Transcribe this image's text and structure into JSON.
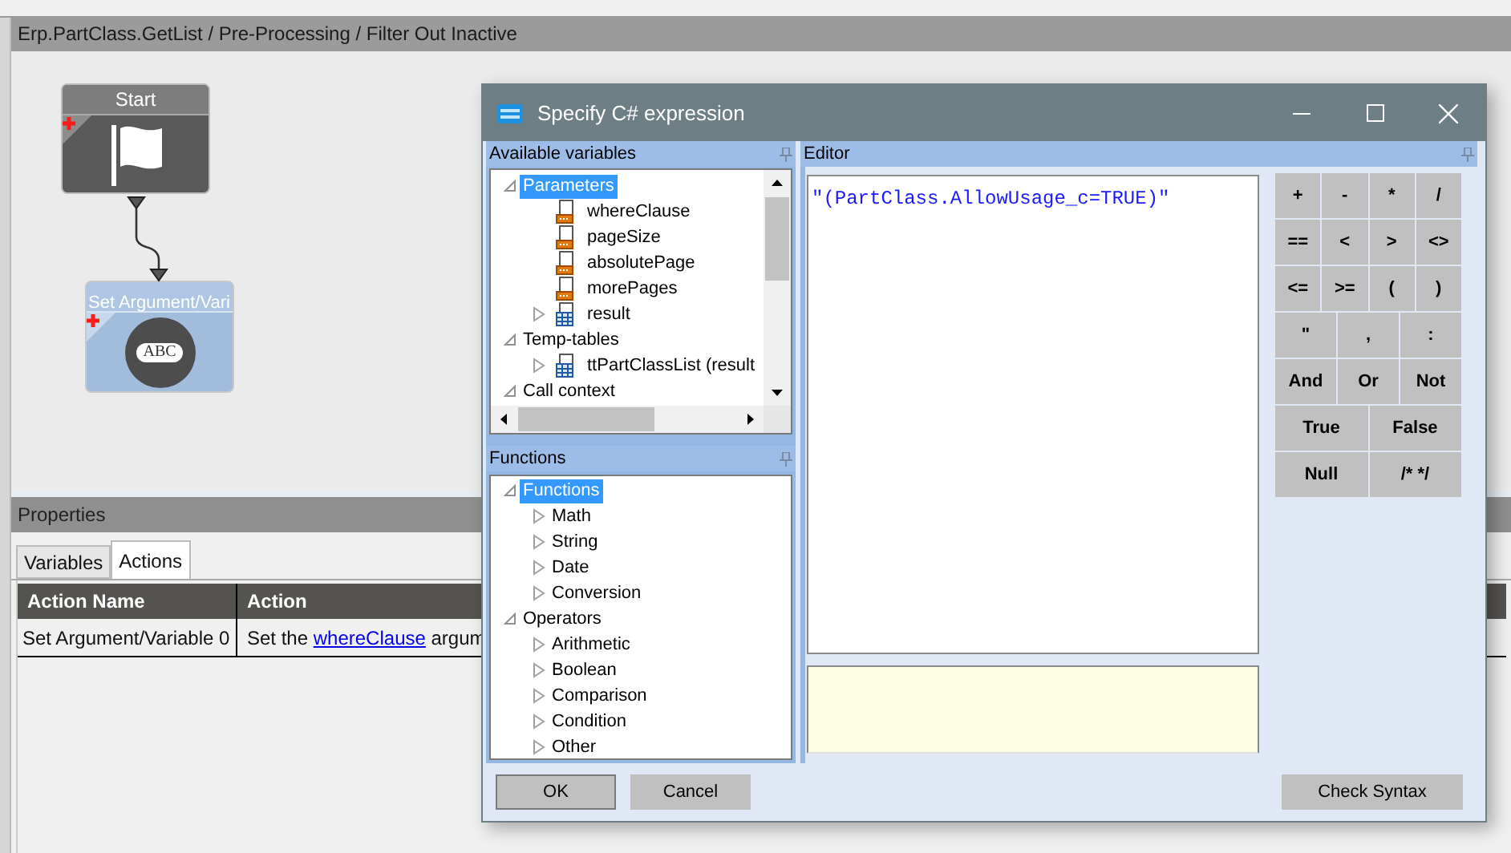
{
  "breadcrumb": "Erp.PartClass.GetList / Pre-Processing / Filter Out Inactive",
  "canvas": {
    "nodes": [
      {
        "kind": "start",
        "title": "Start"
      },
      {
        "kind": "set_argument",
        "title": "Set Argument/Vari",
        "badge": "ABC"
      }
    ]
  },
  "properties": {
    "title": "Properties",
    "tabs": [
      {
        "label": "Variables",
        "selected": false
      },
      {
        "label": "Actions",
        "selected": true
      }
    ],
    "columns": [
      "Action Name",
      "Action"
    ],
    "rows": [
      {
        "action_name": "Set Argument/Variable 0",
        "action_before": "Set the ",
        "action_link": "whereClause",
        "action_after": " argum"
      }
    ]
  },
  "dialog": {
    "title": "Specify C# expression",
    "variables": {
      "title": "Available variables",
      "tree": [
        {
          "label": "Parameters",
          "kind": "group",
          "selected": true,
          "expanded": true,
          "children": [
            {
              "label": "whereClause",
              "kind": "param",
              "selected": false
            },
            {
              "label": "pageSize",
              "kind": "param",
              "selected": false
            },
            {
              "label": "absolutePage",
              "kind": "param",
              "selected": false
            },
            {
              "label": "morePages",
              "kind": "param",
              "selected": false
            },
            {
              "label": "result",
              "kind": "table",
              "selected": false,
              "expanded": false
            }
          ]
        },
        {
          "label": "Temp-tables",
          "kind": "group",
          "selected": false,
          "expanded": true,
          "children": [
            {
              "label": "ttPartClassList (result",
              "kind": "table",
              "selected": false,
              "expanded": false
            }
          ]
        },
        {
          "label": "Call context",
          "kind": "group",
          "selected": false,
          "expanded": true
        }
      ]
    },
    "functions": {
      "title": "Functions",
      "tree": [
        {
          "label": "Functions",
          "kind": "group",
          "selected": true,
          "expanded": true,
          "children": [
            {
              "label": "Math",
              "kind": "group",
              "selected": false,
              "expanded": false
            },
            {
              "label": "String",
              "kind": "group",
              "selected": false,
              "expanded": false
            },
            {
              "label": "Date",
              "kind": "group",
              "selected": false,
              "expanded": false
            },
            {
              "label": "Conversion",
              "kind": "group",
              "selected": false,
              "expanded": false
            }
          ]
        },
        {
          "label": "Operators",
          "kind": "group",
          "selected": false,
          "expanded": true,
          "children": [
            {
              "label": "Arithmetic",
              "kind": "group",
              "selected": false,
              "expanded": false
            },
            {
              "label": "Boolean",
              "kind": "group",
              "selected": false,
              "expanded": false
            },
            {
              "label": "Comparison",
              "kind": "group",
              "selected": false,
              "expanded": false
            },
            {
              "label": "Condition",
              "kind": "group",
              "selected": false,
              "expanded": false
            },
            {
              "label": "Other",
              "kind": "group",
              "selected": false,
              "expanded": false
            }
          ]
        }
      ]
    },
    "editor": {
      "title": "Editor",
      "expression": "\"(PartClass.AllowUsage_c=TRUE)\""
    },
    "keypad": [
      [
        "+",
        "-",
        "*",
        "/"
      ],
      [
        "==",
        "<",
        ">",
        "<>"
      ],
      [
        "<=",
        ">=",
        "(",
        ")"
      ],
      [
        "\"",
        ",",
        ":"
      ],
      [
        "And",
        "Or",
        "Not"
      ],
      [
        "True",
        "False"
      ],
      [
        "Null",
        "/* */"
      ]
    ],
    "buttons": [
      "OK",
      "Cancel"
    ],
    "check_button": "Check Syntax"
  }
}
